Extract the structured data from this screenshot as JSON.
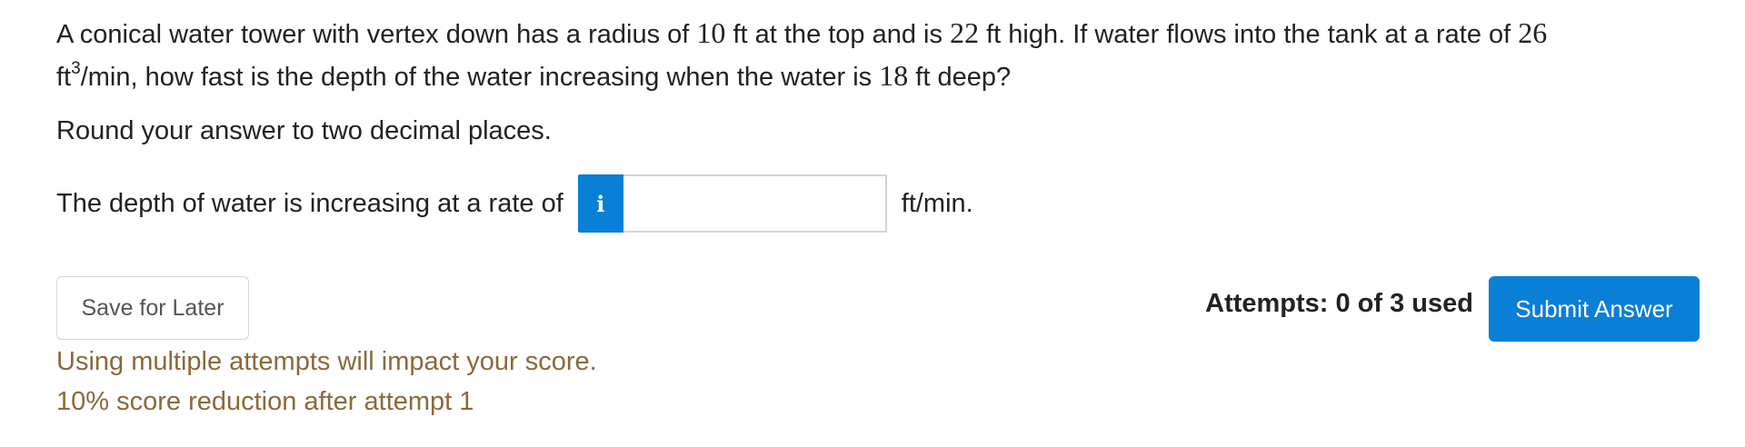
{
  "question": {
    "t1": "A conical water tower with vertex down has a radius of ",
    "radius": "10",
    "t2": " ft at the top and is ",
    "height": "22",
    "t3": " ft high. If water flows into the tank at a rate of ",
    "rate": "26",
    "t4": " ft",
    "exp": "3",
    "t5": "/min, how fast is the depth of the water increasing when the water is ",
    "depth": "18",
    "t6": " ft deep?"
  },
  "instruction": "Round your answer to two decimal places.",
  "answer": {
    "label": "The depth of water is increasing at a rate of",
    "info_icon": "i",
    "input_value": "",
    "unit": "ft/min."
  },
  "save_button": "Save for Later",
  "attempts_text": "Attempts: 0 of 3 used",
  "submit_button": "Submit Answer",
  "warning": {
    "line1": "Using multiple attempts will impact your score.",
    "line2": "10% score reduction after attempt 1"
  },
  "colors": {
    "accent": "#0a7fd6",
    "warning_text": "#8a6a3a"
  }
}
